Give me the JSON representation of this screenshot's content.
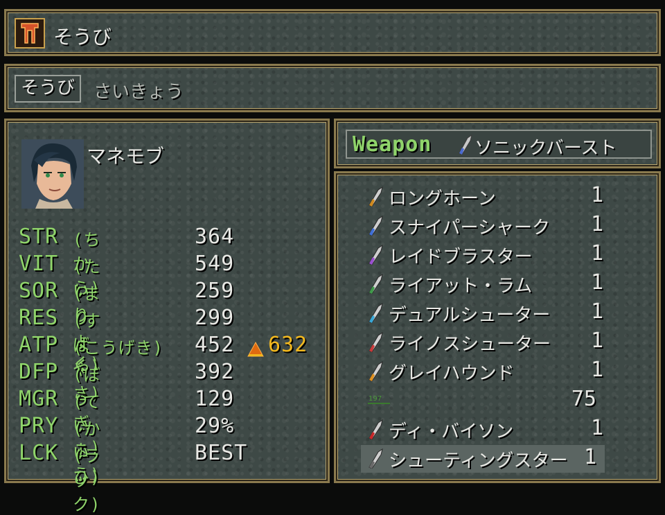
{
  "header": {
    "title": "そうび"
  },
  "tabs": {
    "equip": "そうび",
    "optimize": "さいきょう"
  },
  "character": {
    "name": "マネモブ",
    "stats": [
      {
        "abbr": "STR",
        "label": "(ちから)",
        "value": "364"
      },
      {
        "abbr": "VIT",
        "label": "(たいりょく)",
        "value": "549"
      },
      {
        "abbr": "SOR",
        "label": "(まりょく)",
        "value": "259"
      },
      {
        "abbr": "RES",
        "label": "(すばやさ)",
        "value": "299"
      },
      {
        "abbr": "ATP",
        "label": "(こうげき)",
        "value": "452",
        "new_value": "632",
        "change": "up"
      },
      {
        "abbr": "DFP",
        "label": "(ぼうぎょ)",
        "value": "392"
      },
      {
        "abbr": "MGR",
        "label": "(ていこう)",
        "value": "129"
      },
      {
        "abbr": "PRY",
        "label": "(かいひ)",
        "value": "29%"
      },
      {
        "abbr": "LCK",
        "label": "(ラック)",
        "value": "BEST"
      }
    ]
  },
  "weapon": {
    "slot_label": "Weapon",
    "equipped": "ソニックバースト",
    "icon": "blade-icon"
  },
  "inventory": {
    "items": [
      {
        "name": "ロングホーン",
        "qty": "1",
        "color": "#d08a1f"
      },
      {
        "name": "スナイパーシャーク",
        "qty": "1",
        "color": "#3f6fd8"
      },
      {
        "name": "レイドブラスター",
        "qty": "1",
        "color": "#9a4fd0"
      },
      {
        "name": "ライアット・ラム",
        "qty": "1",
        "color": "#3f9a4a"
      },
      {
        "name": "デュアルシューター",
        "qty": "1",
        "color": "#38a8d8"
      },
      {
        "name": "ライノスシューター",
        "qty": "1",
        "color": "#c83a3a"
      },
      {
        "name": "グレイハウンド",
        "qty": "1",
        "color": "#e0901f"
      }
    ],
    "gil": "75",
    "items_after": [
      {
        "name": "ディ・バイソン",
        "qty": "1",
        "color": "#c8282a"
      },
      {
        "name": "シューティングスター",
        "qty": "1",
        "color": "#6a6a6a",
        "selected": true
      }
    ]
  }
}
